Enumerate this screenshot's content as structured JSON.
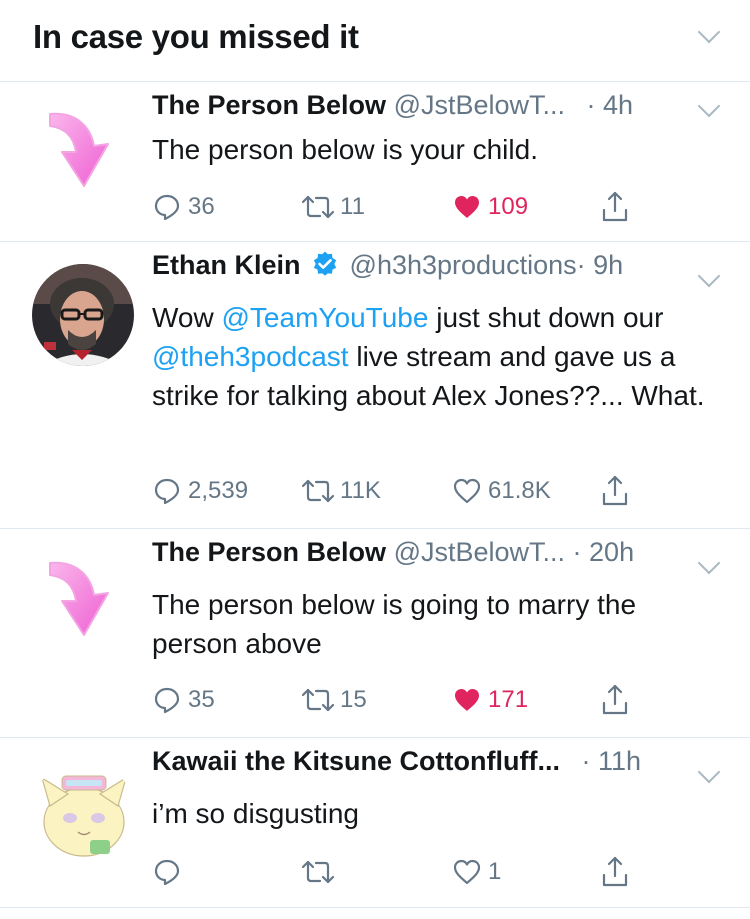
{
  "header": {
    "title": "In case you missed it"
  },
  "tweets": [
    {
      "name": "The Person Below",
      "handle": "@JstBelowT...",
      "time": "· 4h",
      "text": "The person below is your child.",
      "replies": "36",
      "retweets": "11",
      "likes": "109",
      "liked": true
    },
    {
      "name": "Ethan Klein",
      "verified": true,
      "handle": "@h3h3productions",
      "time": "· 9h",
      "text_parts": {
        "p1": "Wow ",
        "m1": "@TeamYouTube",
        "p2": " just shut down our ",
        "m2": "@theh3podcast",
        "p3": " live stream and gave us a strike for talking about Alex Jones??... What."
      },
      "replies": "2,539",
      "retweets": "11K",
      "likes": "61.8K",
      "liked": false
    },
    {
      "name": "The Person Below",
      "handle": "@JstBelowT...",
      "time": "· 20h",
      "text": "The person below is going to marry the person above",
      "replies": "35",
      "retweets": "15",
      "likes": "171",
      "liked": true
    },
    {
      "name": "Kawaii the Kitsune Cottonfluff...",
      "handle": "",
      "time": "· 11h",
      "text": "i’m so disgusting",
      "replies": "",
      "retweets": "",
      "likes": "1",
      "liked": false
    }
  ],
  "colors": {
    "accent": "#1da1f2",
    "like": "#e0245e",
    "secondary_text": "#657786",
    "arrow_pink": "#f06fd8",
    "verified": "#1da1f2"
  },
  "icons": [
    "chevron-down-icon",
    "pink-arrow-icon",
    "reply-icon",
    "retweet-icon",
    "heart-icon",
    "share-icon",
    "verified-badge-icon"
  ]
}
